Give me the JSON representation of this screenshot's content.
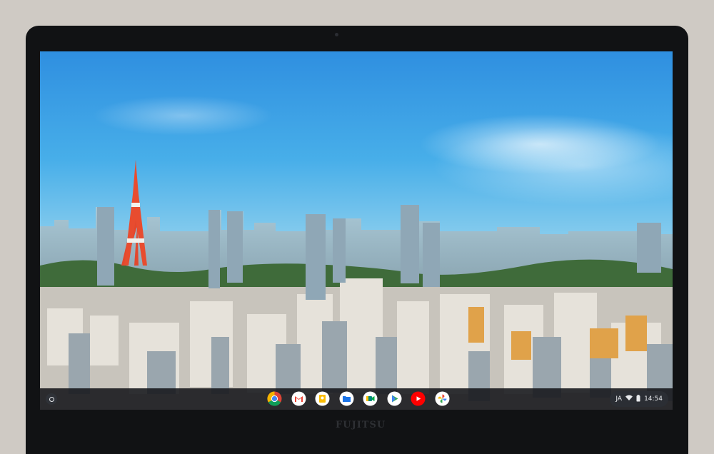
{
  "device": {
    "brand_label": "FUJITSU"
  },
  "shelf": {
    "apps": [
      {
        "name": "chrome-icon"
      },
      {
        "name": "gmail-icon"
      },
      {
        "name": "google-keep-icon"
      },
      {
        "name": "files-icon"
      },
      {
        "name": "google-meet-icon"
      },
      {
        "name": "play-store-icon"
      },
      {
        "name": "youtube-icon"
      },
      {
        "name": "google-photos-icon"
      }
    ],
    "tray": {
      "ime": "JA",
      "time": "14:54"
    }
  }
}
